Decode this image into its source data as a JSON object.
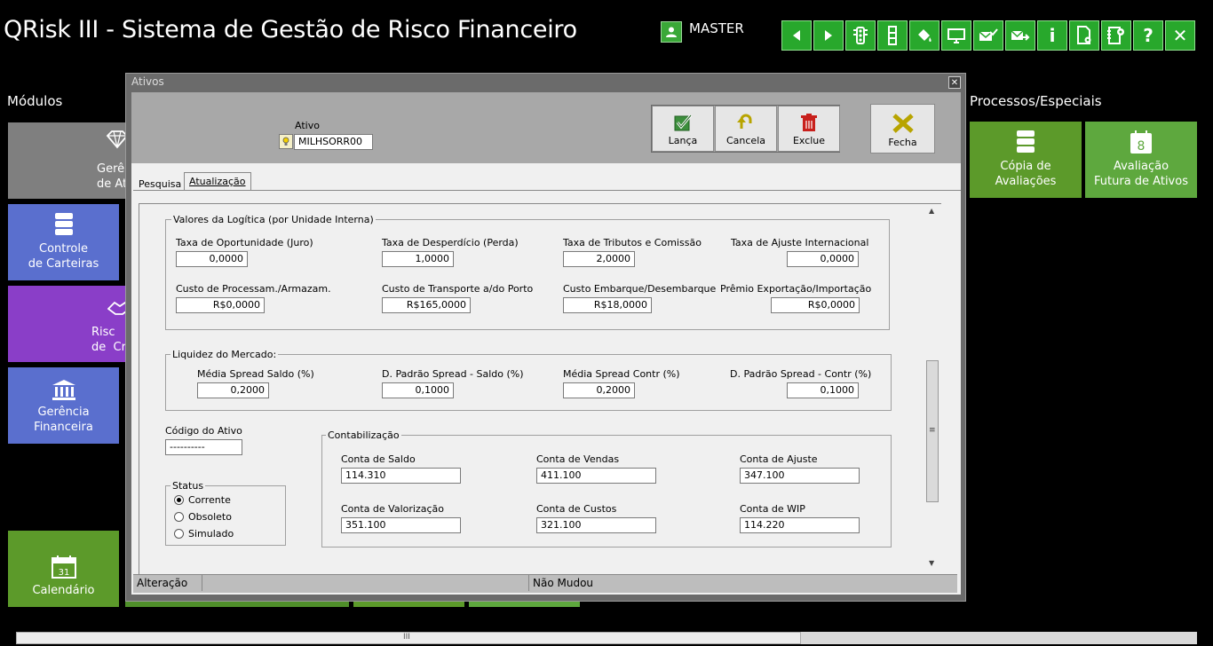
{
  "app": {
    "title": "QRisk III - Sistema de Gestão de Risco Financeiro",
    "user": "MASTER"
  },
  "toolbar": {
    "buttons": [
      "back",
      "forward",
      "traffic-light",
      "traffic-light-vertical",
      "paint-bucket",
      "monitor",
      "mail-check",
      "mail-forward",
      "info",
      "document-settings",
      "book-settings",
      "help",
      "close"
    ],
    "glyphs": {
      "info": "i",
      "help": "?",
      "close": "✕"
    }
  },
  "modules": {
    "label": "Módulos",
    "tiles": [
      {
        "label": "Gerê\nde At",
        "color": "#7f7f7f"
      },
      {
        "label": "Controle\nde Carteiras",
        "color": "#5a6fce"
      },
      {
        "label": "Risc\nde  Cr",
        "color": "#8a3ec8"
      },
      {
        "label": "Gerência\nFinanceira",
        "color": "#5a6fce"
      },
      {
        "label": "Calendário",
        "color": "#5c9a2a"
      }
    ]
  },
  "processes": {
    "label": "Processos/Especiais",
    "tiles": [
      {
        "label": "Cópia de\nAvaliações",
        "color": "#5c9a2a"
      },
      {
        "label": "Avaliação\nFutura de Ativos",
        "color": "#5ea83e"
      }
    ]
  },
  "dialog": {
    "title": "Ativos",
    "ativo_label": "Ativo",
    "ativo_value": "MILHSORR00",
    "actions": {
      "lanca": "Lança",
      "cancela": "Cancela",
      "exclue": "Exclue",
      "fecha": "Fecha"
    },
    "tabs": [
      "Pesquisa",
      "Atualização"
    ],
    "logistica": {
      "title": "Valores da Logítica (por Unidade Interna)",
      "fields": [
        {
          "label": "Taxa de Oportunidade (Juro)",
          "value": "0,0000"
        },
        {
          "label": "Taxa de Desperdício (Perda)",
          "value": "1,0000"
        },
        {
          "label": "Taxa de Tributos e Comissão",
          "value": "2,0000"
        },
        {
          "label": "Taxa de Ajuste Internacional",
          "value": "0,0000"
        },
        {
          "label": "Custo de Processam./Armazam.",
          "value": "R$0,0000"
        },
        {
          "label": "Custo de Transporte a/do Porto",
          "value": "R$165,0000"
        },
        {
          "label": "Custo Embarque/Desembarque",
          "value": "R$18,0000"
        },
        {
          "label": "Prêmio Exportação/Importação",
          "value": "R$0,0000"
        }
      ]
    },
    "liquidez": {
      "title": "Liquidez do Mercado:",
      "fields": [
        {
          "label": "Média Spread Saldo (%)",
          "value": "0,2000"
        },
        {
          "label": "D. Padrão Spread - Saldo (%)",
          "value": "0,1000"
        },
        {
          "label": "Média Spread Contr (%)",
          "value": "0,2000"
        },
        {
          "label": "D. Padrão Spread - Contr (%)",
          "value": "0,1000"
        }
      ]
    },
    "codigo": {
      "label": "Código do Ativo",
      "value": "----------"
    },
    "status": {
      "title": "Status",
      "options": [
        "Corrente",
        "Obsoleto",
        "Simulado"
      ],
      "selected": "Corrente"
    },
    "contabilizacao": {
      "title": "Contabilização",
      "fields": [
        {
          "label": "Conta de Saldo",
          "value": "114.310"
        },
        {
          "label": "Conta de Vendas",
          "value": "411.100"
        },
        {
          "label": "Conta de Ajuste",
          "value": "347.100"
        },
        {
          "label": "Conta de Valorização",
          "value": "351.100"
        },
        {
          "label": "Conta de Custos",
          "value": "321.100"
        },
        {
          "label": "Conta de WIP",
          "value": "114.220"
        }
      ]
    },
    "statusbar": {
      "left": "Alteração",
      "middle": "",
      "right": "Não Mudou"
    }
  },
  "scrollbar": {
    "grip": "III"
  },
  "colors": {
    "toolbar_green": "#28a82c",
    "dialog_bg": "#f0f0f0"
  }
}
